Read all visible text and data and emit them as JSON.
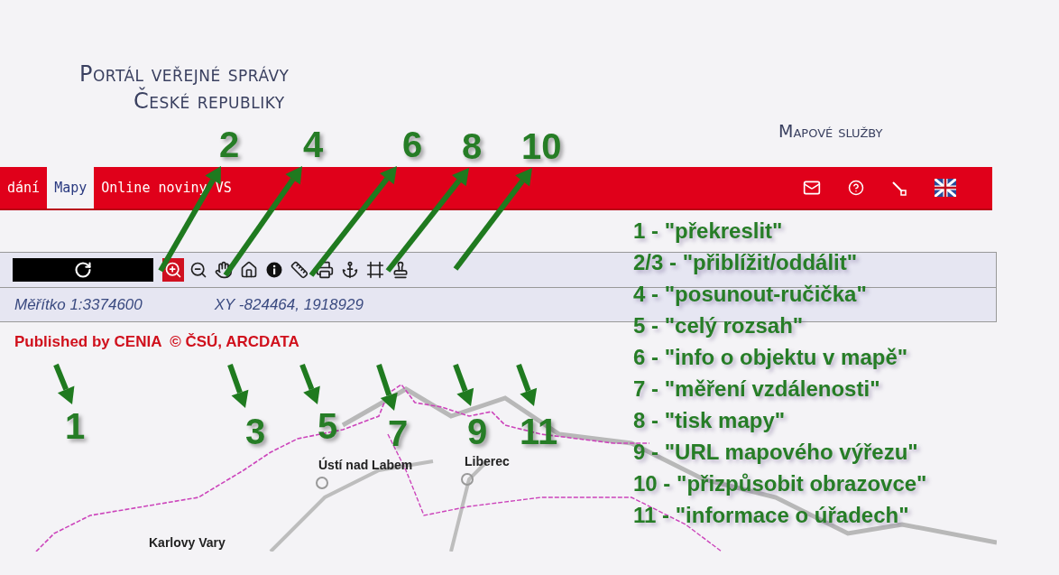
{
  "header": {
    "title_line_1": "Portál veřejné správy",
    "title_line_2": "České republiky",
    "section_title": "Mapové služby"
  },
  "nav": {
    "tabs": [
      {
        "label": "dání",
        "selected": false
      },
      {
        "label": "Mapy",
        "selected": true
      },
      {
        "label": "Online noviny VS",
        "selected": false
      }
    ]
  },
  "toolbar": {
    "tools": [
      {
        "kind": "redraw",
        "selected": false
      },
      {
        "kind": "zoom-in",
        "selected": true
      },
      {
        "kind": "zoom-out",
        "selected": false
      },
      {
        "kind": "pan",
        "selected": false
      },
      {
        "kind": "full-extent",
        "selected": false
      },
      {
        "kind": "info",
        "selected": false
      },
      {
        "kind": "measure",
        "selected": false
      },
      {
        "kind": "print",
        "selected": false
      },
      {
        "kind": "url",
        "selected": false
      },
      {
        "kind": "fit",
        "selected": false
      },
      {
        "kind": "offices",
        "selected": false
      }
    ]
  },
  "status": {
    "scale": "Měřítko 1:3374600",
    "coordinates": "XY -824464, 1918929"
  },
  "credit": "Published by CENIA  © ČSÚ, ARCDATA",
  "map": {
    "cities": [
      {
        "name": "Ústí nad Labem"
      },
      {
        "name": "Liberec"
      },
      {
        "name": "Karlovy Vary"
      }
    ]
  },
  "annotations": {
    "markers": [
      {
        "number": "1"
      },
      {
        "number": "2"
      },
      {
        "number": "3"
      },
      {
        "number": "4"
      },
      {
        "number": "5"
      },
      {
        "number": "6"
      },
      {
        "number": "7"
      },
      {
        "number": "8"
      },
      {
        "number": "9"
      },
      {
        "number": "10"
      },
      {
        "number": "11"
      }
    ],
    "legend": [
      "1 - \"překreslit\"",
      "2/3 - \"přiblížit/oddálit\"",
      "4 - \"posunout-ručička\"",
      "5 - \"celý rozsah\"",
      "6 - \"info o objektu v mapě\"",
      "7 - \"měření vzdálenosti\"",
      "8 - \"tisk mapy\"",
      "9 - \"URL mapového výřezu\"",
      "10 - \"přizpůsobit obrazovce\"",
      "11 - \"informace o úřadech\""
    ]
  }
}
